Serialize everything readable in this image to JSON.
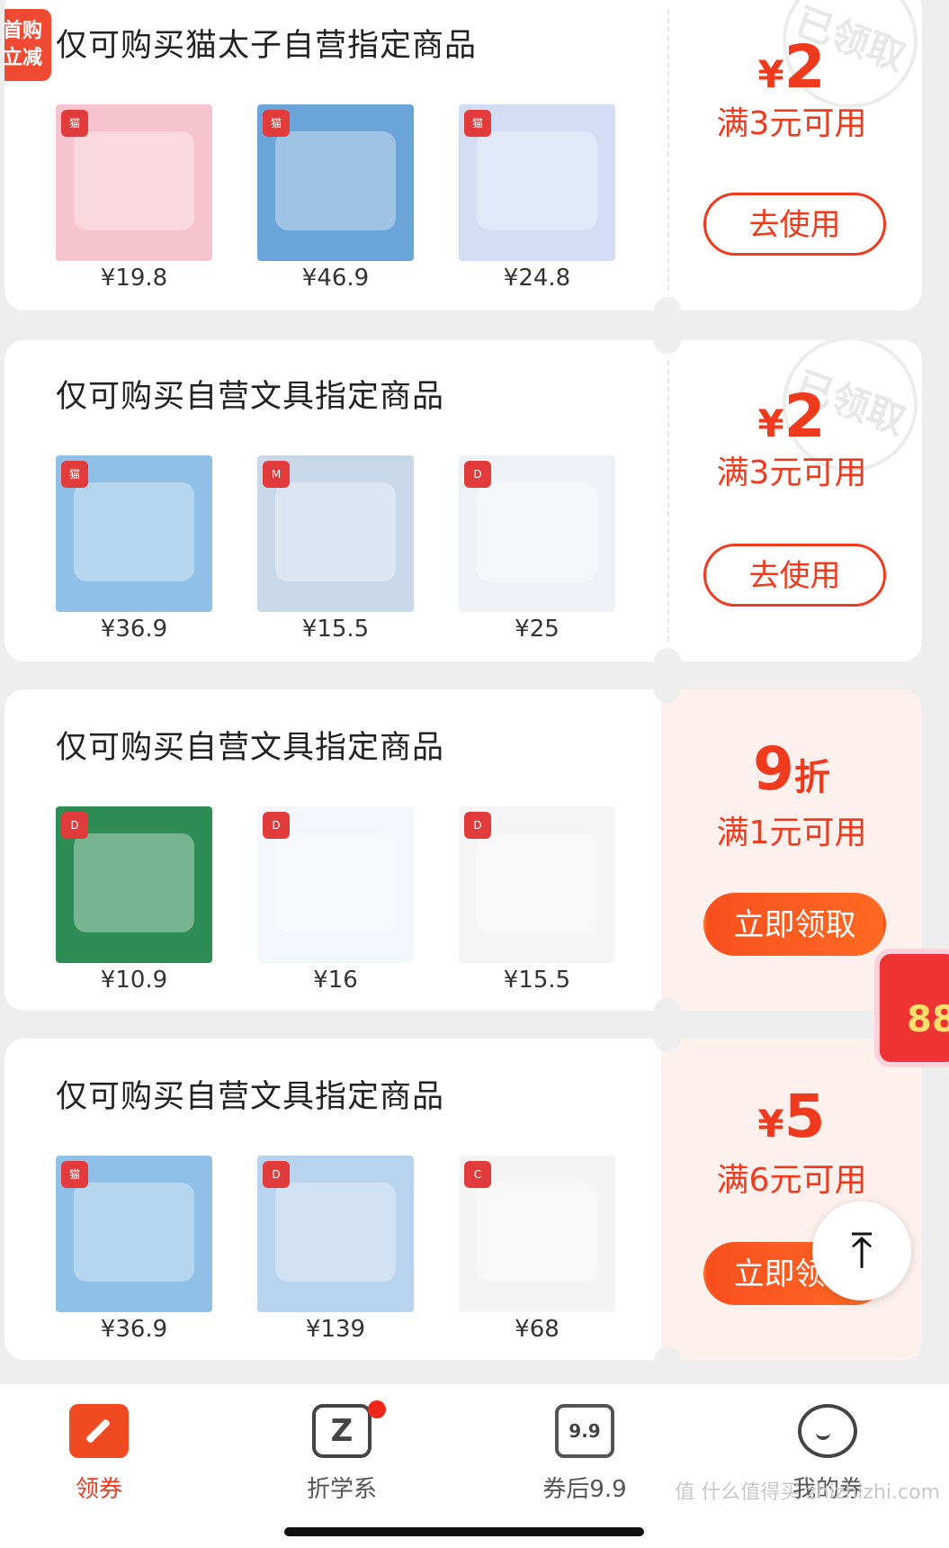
{
  "coupons": [
    {
      "title": "仅可购买猫太子自营指定商品",
      "badge": "首购立减",
      "amount_symbol": "¥",
      "amount": "2",
      "amount_unit": "",
      "condition": "满3元可用",
      "button": "去使用",
      "stamp": "已领取",
      "products": [
        {
          "price": "¥19.8",
          "color": "#f7c3cf",
          "logo": "猫"
        },
        {
          "price": "¥46.9",
          "color": "#6aa4d8",
          "logo": "猫"
        },
        {
          "price": "¥24.8",
          "color": "#d2dcf3",
          "logo": "猫"
        }
      ]
    },
    {
      "title": "仅可购买自营文具指定商品",
      "amount_symbol": "¥",
      "amount": "2",
      "amount_unit": "",
      "condition": "满3元可用",
      "button": "去使用",
      "stamp": "已领取",
      "products": [
        {
          "price": "¥36.9",
          "color": "#8fc0e8",
          "logo": "猫"
        },
        {
          "price": "¥15.5",
          "color": "#c9d8e8",
          "logo": "M"
        },
        {
          "price": "¥25",
          "color": "#eef2f7",
          "logo": "D"
        }
      ]
    },
    {
      "title": "仅可购买自营文具指定商品",
      "amount_symbol": "",
      "amount": "9",
      "amount_unit": "折",
      "condition": "满1元可用",
      "button": "立即领取",
      "products": [
        {
          "price": "¥10.9",
          "color": "#2e8c55",
          "logo": "D"
        },
        {
          "price": "¥16",
          "color": "#f3f6fa",
          "logo": "D"
        },
        {
          "price": "¥15.5",
          "color": "#f5f5f5",
          "logo": "D"
        }
      ]
    },
    {
      "title": "仅可购买自营文具指定商品",
      "amount_symbol": "¥",
      "amount": "5",
      "amount_unit": "",
      "condition": "满6元可用",
      "button": "立即领取",
      "products": [
        {
          "price": "¥36.9",
          "color": "#8fc0e8",
          "logo": "猫"
        },
        {
          "price": "¥139",
          "color": "#b7d3ee",
          "logo": "D"
        },
        {
          "price": "¥68",
          "color": "#f4f4f4",
          "logo": "C"
        }
      ]
    }
  ],
  "floating": {
    "redpack_text": "88"
  },
  "tabbar": {
    "tabs": [
      {
        "label": "领券",
        "icon": "coupon-icon"
      },
      {
        "label": "折学系",
        "icon": "z-icon"
      },
      {
        "label": "券后9.9",
        "icon": "price-99-icon",
        "icon_text": "9.9"
      },
      {
        "label": "我的券",
        "icon": "smile-icon"
      }
    ]
  },
  "watermark": "值 什么值得买 zhizhizhi.com",
  "colors": {
    "accent": "#f03a1e",
    "pink_panel": "#fdf0ed"
  }
}
